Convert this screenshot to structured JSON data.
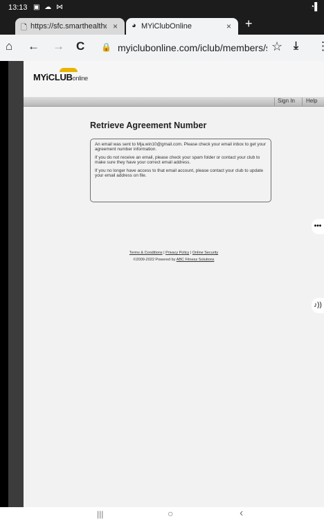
{
  "status_bar": {
    "time": "13:13",
    "icons": "▣ ☁ ⋈",
    "wifi": "◔▌"
  },
  "tabs": [
    {
      "label": "https://sfc.smarthealthclub",
      "icon": "page-icon",
      "active": false
    },
    {
      "label": "MYiClubOnline",
      "icon": "favicon",
      "active": true
    }
  ],
  "toolbar": {
    "url": "myiclubonline.com/iclub/members/signin",
    "home": "⌂",
    "back": "←",
    "forward": "→",
    "reload": "C",
    "lock": "🔒",
    "star": "☆",
    "download": "⤓",
    "menu": "⋮",
    "new_tab": "+",
    "close": "×"
  },
  "logo": {
    "myi": "MY",
    "club": "iCLUB",
    "online": "online"
  },
  "nav": {
    "sign_in": "Sign In",
    "help": "Help"
  },
  "main": {
    "title": "Retrieve Agreement Number",
    "messages": [
      "An email was sent to Mja.win10@gmail.com. Please check your email inbox to get your agreement number information.",
      "If you do not receive an email, please check your spam folder or contact your club to make sure they have your correct email address.",
      "If you no longer have access to that email account, please contact your club to update your email address on file."
    ]
  },
  "footer": {
    "terms": "Terms & Conditions",
    "privacy": "Privacy Policy",
    "security": "Online Security",
    "separator": "|",
    "copyright_prefix": "©2009-2022 Powered by",
    "powered_by": "ABC Fitness Solutions"
  },
  "side_handles": {
    "more": "•••",
    "audio": "♪))"
  },
  "android_nav": {
    "recents": "|||",
    "home": "○",
    "back": "‹"
  }
}
